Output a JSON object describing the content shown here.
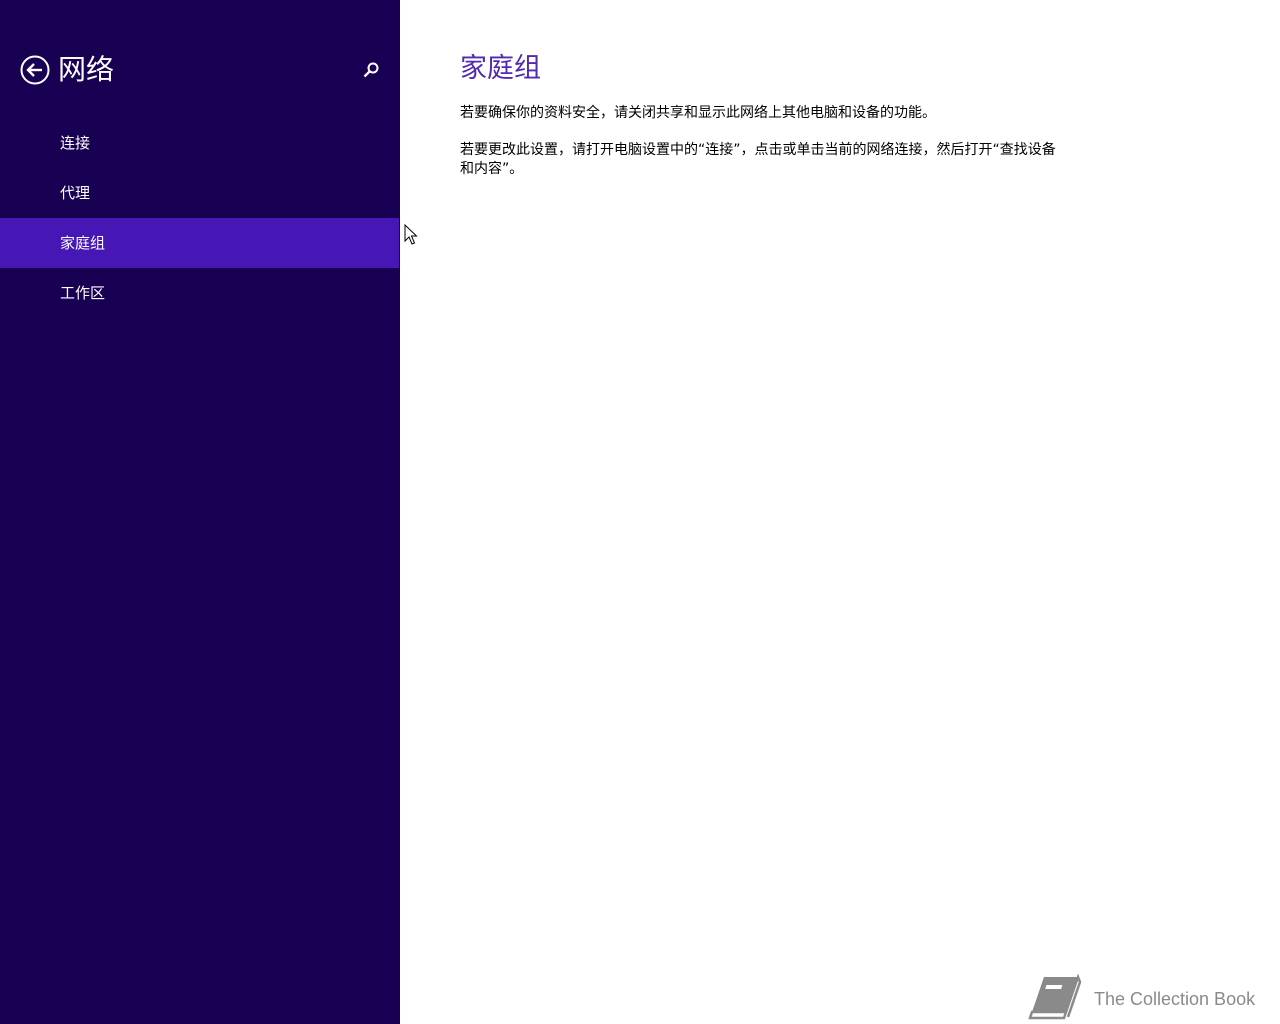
{
  "sidebar": {
    "title": "网络",
    "back_icon": "back-arrow-circle-icon",
    "search_icon": "search-icon",
    "background_color": "#180052",
    "selected_color": "#4617b4",
    "items": [
      {
        "label": "连接",
        "selected": false
      },
      {
        "label": "代理",
        "selected": false
      },
      {
        "label": "家庭组",
        "selected": true
      },
      {
        "label": "工作区",
        "selected": false
      }
    ]
  },
  "main": {
    "title": "家庭组",
    "title_color": "#5229b0",
    "paragraphs": [
      "若要确保你的资料安全，请关闭共享和显示此网络上其他电脑和设备的功能。",
      "若要更改此设置，请打开电脑设置中的“连接”，点击或单击当前的网络连接，然后打开“查找设备和内容”。"
    ]
  },
  "watermark": {
    "text": "The Collection Book",
    "icon": "book-icon"
  }
}
